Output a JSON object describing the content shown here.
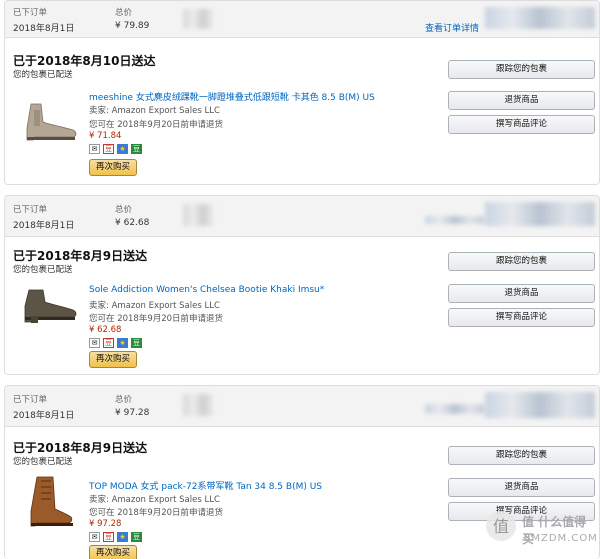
{
  "header_labels": {
    "order_date": "已下订单",
    "total": "总价"
  },
  "view_details": "查看订单详情",
  "orders": [
    {
      "date": "2018年8月1日",
      "total": "¥ 79.89",
      "status": "已于2018年8月10日送达",
      "substatus": "您的包裹已配送",
      "title": "meeshine 女式麂皮绒踝靴一脚蹬堆叠式低跟短靴 卡其色 8.5 B(M) US",
      "seller": "卖家: Amazon Export Sales LLC",
      "return": "您可在 2018年9月20日前申请退货",
      "price": "¥ 71.84"
    },
    {
      "date": "2018年8月1日",
      "total": "¥ 62.68",
      "status": "已于2018年8月9日送达",
      "substatus": "您的包裹已配送",
      "title": "Sole Addiction Women's Chelsea Bootie Khaki Imsu*",
      "seller": "卖家: Amazon Export Sales LLC",
      "return": "您可在 2018年9月20日前申请退货",
      "price": "¥ 62.68"
    },
    {
      "date": "2018年8月1日",
      "total": "¥ 97.28",
      "status": "已于2018年8月9日送达",
      "substatus": "您的包裹已配送",
      "title": "TOP MODA 女式 pack-72系带军靴 Tan 34 8.5 B(M) US",
      "seller": "卖家: Amazon Export Sales LLC",
      "return": "您可在 2018年9月20日前申请退货",
      "price": "¥ 97.28"
    }
  ],
  "buttons": {
    "track": "跟踪您的包裹",
    "return": "退货商品",
    "review": "撰写商品评论",
    "buy_again": "再次购买"
  },
  "icons": [
    "mail-icon",
    "dou-icon",
    "star-icon",
    "dou-icon"
  ],
  "icon_glyphs": {
    "mail": "✉",
    "dou": "豆",
    "star": "★"
  },
  "watermark": {
    "line1": "值 什么值得买",
    "line2": "SMZDM.COM"
  },
  "colors": {
    "link": "#0066c0",
    "price": "#b12704",
    "header_bg": "#f3f3f3",
    "buy_again": "#f0c14b"
  }
}
